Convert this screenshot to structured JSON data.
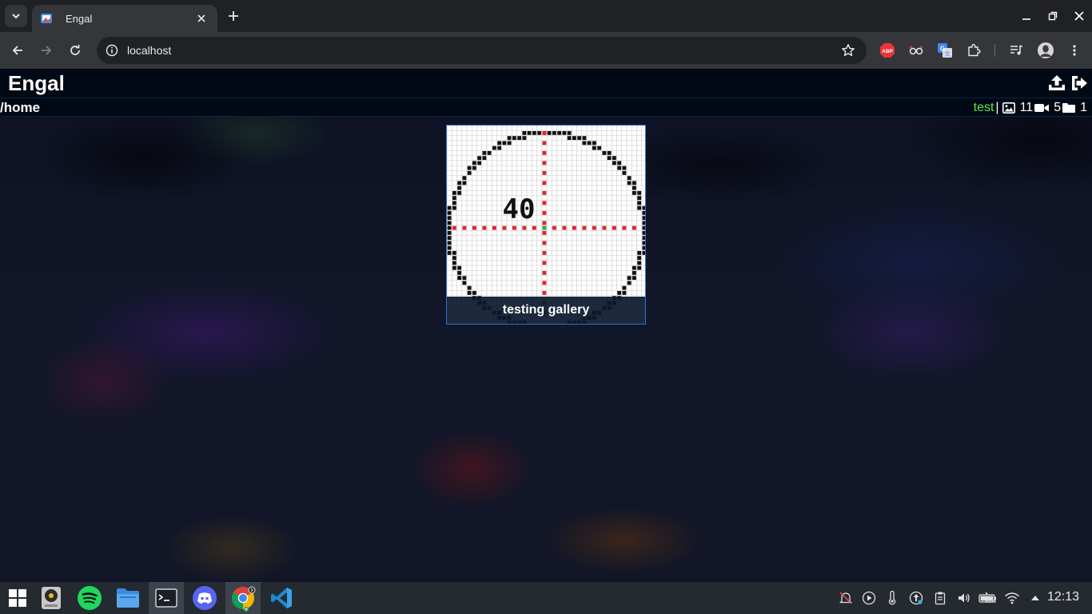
{
  "browser": {
    "tab_title": "Engal",
    "url": "localhost"
  },
  "app": {
    "title": "Engal",
    "path": "/home",
    "username": "test",
    "separator": "|",
    "image_count": "11",
    "video_count": "5",
    "folder_count": "1"
  },
  "gallery": [
    {
      "name": "testing gallery",
      "thumbnail_text": "40"
    }
  ],
  "taskbar": {
    "clock": "12:13",
    "battery": "98%"
  },
  "colors": {
    "accent_green": "#5fe64a",
    "card_border": "#2f6fd1",
    "header_bg": "#000914"
  }
}
